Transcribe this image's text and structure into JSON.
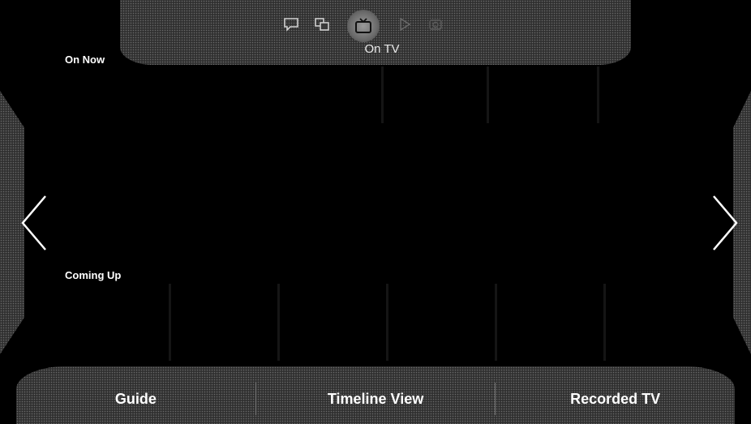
{
  "top_nav": {
    "active_label": "On TV",
    "icons": [
      "chat-icon",
      "multi-screen-icon",
      "tv-icon",
      "play-icon",
      "camera-icon"
    ]
  },
  "rows": {
    "on_now_label": "On Now",
    "coming_up_label": "Coming Up"
  },
  "bottom_bar": {
    "guide_label": "Guide",
    "timeline_label": "Timeline View",
    "recorded_label": "Recorded TV"
  },
  "colors": {
    "background": "#000000",
    "panel": "#3a3a3a",
    "text": "#ffffff"
  }
}
